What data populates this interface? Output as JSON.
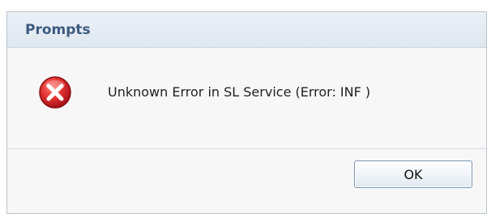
{
  "dialog": {
    "title": "Prompts",
    "message": "Unknown Error in SL Service (Error: INF )",
    "icon": "error-icon",
    "ok_label": "OK"
  },
  "colors": {
    "title_text": "#3d5a80",
    "error_red": "#d7262b",
    "button_border": "#7a96b3"
  }
}
